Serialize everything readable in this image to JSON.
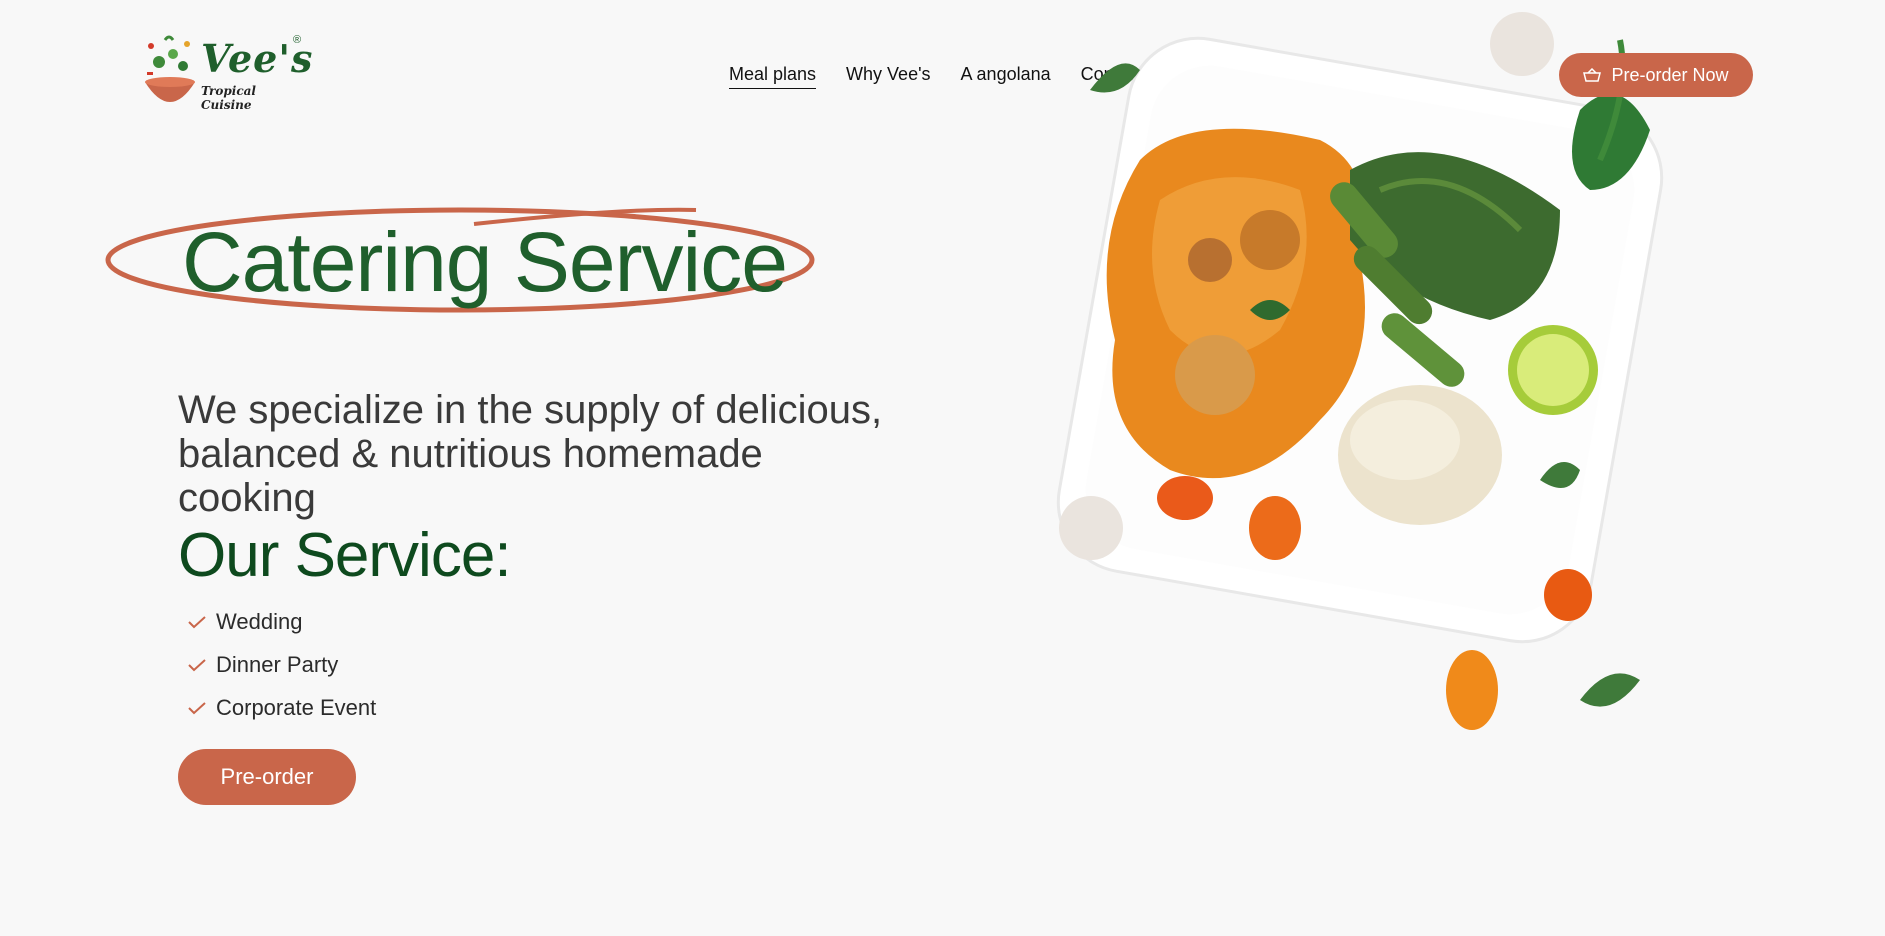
{
  "brand": {
    "name": "Vee's",
    "tagline": "Tropical Cuisine",
    "registered": "®"
  },
  "nav": {
    "items": [
      {
        "label": "Meal plans",
        "active": true
      },
      {
        "label": "Why Vee's",
        "active": false
      },
      {
        "label": "A angolana",
        "active": false
      },
      {
        "label": "Contact Us",
        "active": false
      }
    ]
  },
  "header_cta": {
    "label": "Pre-order Now",
    "icon": "basket-icon"
  },
  "hero": {
    "title": "Catering Service",
    "tagline": "We specialize in the supply of delicious, balanced & nutritious homemade cooking"
  },
  "services": {
    "heading": "Our Service:",
    "items": [
      "Wedding",
      "Dinner Party",
      "Corporate Event"
    ],
    "check_icon": "check-icon"
  },
  "preorder": {
    "label": "Pre-order"
  },
  "colors": {
    "accent": "#c9664a",
    "brand_green": "#1f5f2c",
    "dark_green": "#0e4a1e",
    "background": "#f8f8f8"
  },
  "image": {
    "icon": "food-plate-illustration"
  }
}
